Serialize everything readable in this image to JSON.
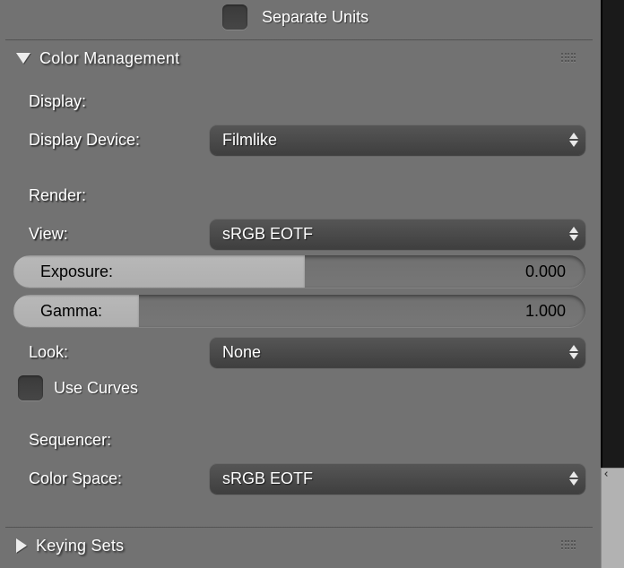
{
  "top": {
    "separate_units_label": "Separate Units"
  },
  "panels": {
    "color_management": {
      "title": "Color Management",
      "display_heading": "Display:",
      "display_device_label": "Display Device:",
      "display_device_value": "Filmlike",
      "render_heading": "Render:",
      "view_label": "View:",
      "view_value": "sRGB EOTF",
      "exposure_label": "Exposure:",
      "exposure_value": "0.000",
      "gamma_label": "Gamma:",
      "gamma_value": "1.000",
      "look_label": "Look:",
      "look_value": "None",
      "use_curves_label": "Use Curves",
      "sequencer_heading": "Sequencer:",
      "color_space_label": "Color Space:",
      "color_space_value": "sRGB EOTF"
    },
    "keying_sets": {
      "title": "Keying Sets"
    }
  },
  "chart_data": {
    "type": "table",
    "title": "Color Management",
    "rows": [
      {
        "group": "Display",
        "property": "Display Device",
        "value": "Filmlike"
      },
      {
        "group": "Render",
        "property": "View",
        "value": "sRGB EOTF"
      },
      {
        "group": "Render",
        "property": "Exposure",
        "value": 0.0
      },
      {
        "group": "Render",
        "property": "Gamma",
        "value": 1.0
      },
      {
        "group": "Render",
        "property": "Look",
        "value": "None"
      },
      {
        "group": "Render",
        "property": "Use Curves",
        "value": false
      },
      {
        "group": "Sequencer",
        "property": "Color Space",
        "value": "sRGB EOTF"
      }
    ]
  }
}
